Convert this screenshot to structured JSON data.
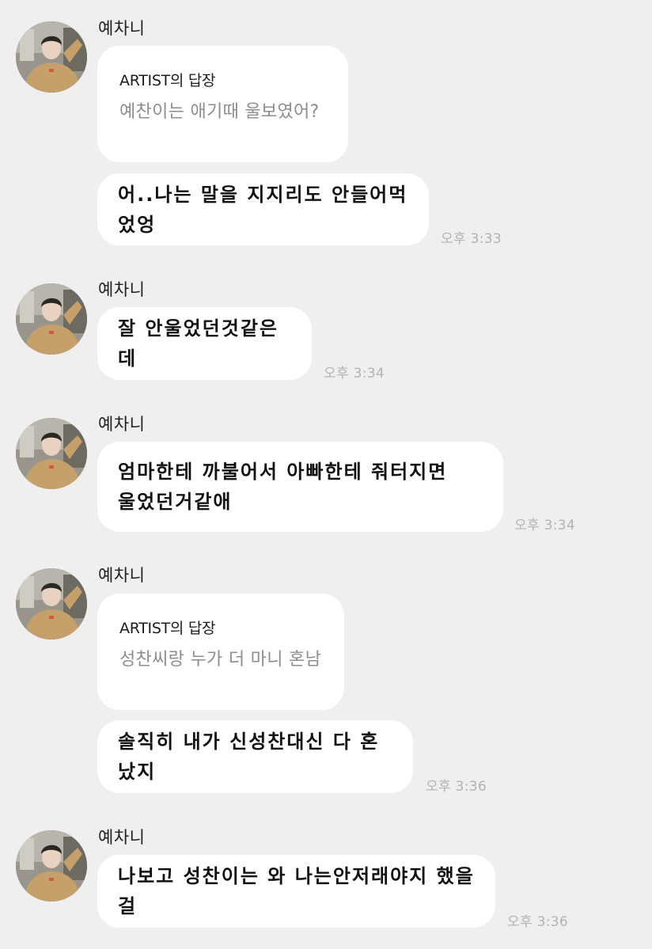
{
  "conversation": [
    {
      "sender": "예차니",
      "avatar": "profile-photo",
      "reply_label": "ARTIST의 답장",
      "reply_quote": "예찬이는 애기때 울보였어?",
      "message": "어..나는 말을 지지리도 안들어먹었엉",
      "time": "오후 3:33"
    },
    {
      "sender": "예차니",
      "avatar": "profile-photo",
      "message": "잘 안울었던것같은데",
      "time": "오후 3:34"
    },
    {
      "sender": "예차니",
      "avatar": "profile-photo",
      "message": "엄마한테 까불어서 아빠한테 줘터지면\n울었던거같애",
      "time": "오후 3:34"
    },
    {
      "sender": "예차니",
      "avatar": "profile-photo",
      "reply_label": "ARTIST의 답장",
      "reply_quote": "성찬씨랑 누가 더 마니 혼남",
      "message": "솔직히 내가 신성찬대신 다 혼났지",
      "time": "오후 3:36"
    },
    {
      "sender": "예차니",
      "avatar": "profile-photo",
      "message": "나보고 성찬이는 와 나는안저래야지 했을걸",
      "time": "오후 3:36"
    }
  ],
  "colors": {
    "background": "#efefef",
    "bubble": "#ffffff",
    "timestamp": "#b2b2b2",
    "reply_quote": "#8d8d8d"
  }
}
